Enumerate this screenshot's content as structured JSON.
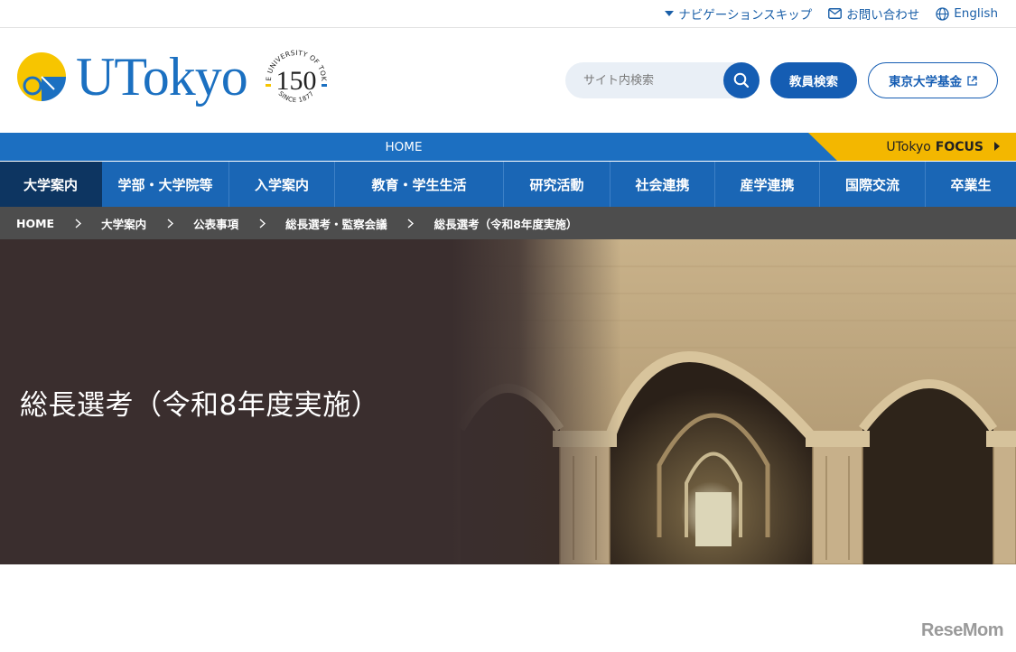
{
  "utility": {
    "skip_nav": "ナビゲーションスキップ",
    "contact": "お問い合わせ",
    "english": "English"
  },
  "header": {
    "wordmark": "UTokyo",
    "seal_number": "150",
    "seal_top_text": "THE UNIVERSITY OF TOKYO",
    "seal_bottom_text": "SINCE 1877",
    "search_placeholder": "サイト内検索",
    "faculty_search": "教員検索",
    "fund": "東京大学基金"
  },
  "homebar": {
    "home": "HOME",
    "focus_prefix": "UTokyo",
    "focus_bold": "FOCUS"
  },
  "nav": {
    "items": [
      {
        "label": "大学案内",
        "active": true
      },
      {
        "label": "学部・大学院等"
      },
      {
        "label": "入学案内"
      },
      {
        "label": "教育・学生生活"
      },
      {
        "label": "研究活動"
      },
      {
        "label": "社会連携"
      },
      {
        "label": "産学連携"
      },
      {
        "label": "国際交流"
      },
      {
        "label": "卒業生"
      }
    ]
  },
  "breadcrumb": [
    "HOME",
    "大学案内",
    "公表事項",
    "総長選考・監察会議",
    "総長選考（令和8年度実施）"
  ],
  "hero": {
    "title": "総長選考（令和8年度実施）"
  },
  "watermark": "ReseMom",
  "colors": {
    "brand_blue": "#1b70c1",
    "nav_blue": "#1a66b5",
    "nav_active": "#0d3561",
    "focus_yellow": "#f3b700",
    "breadcrumb_gray": "#4d4d4d",
    "hero_dark": "#3a2e2e"
  }
}
